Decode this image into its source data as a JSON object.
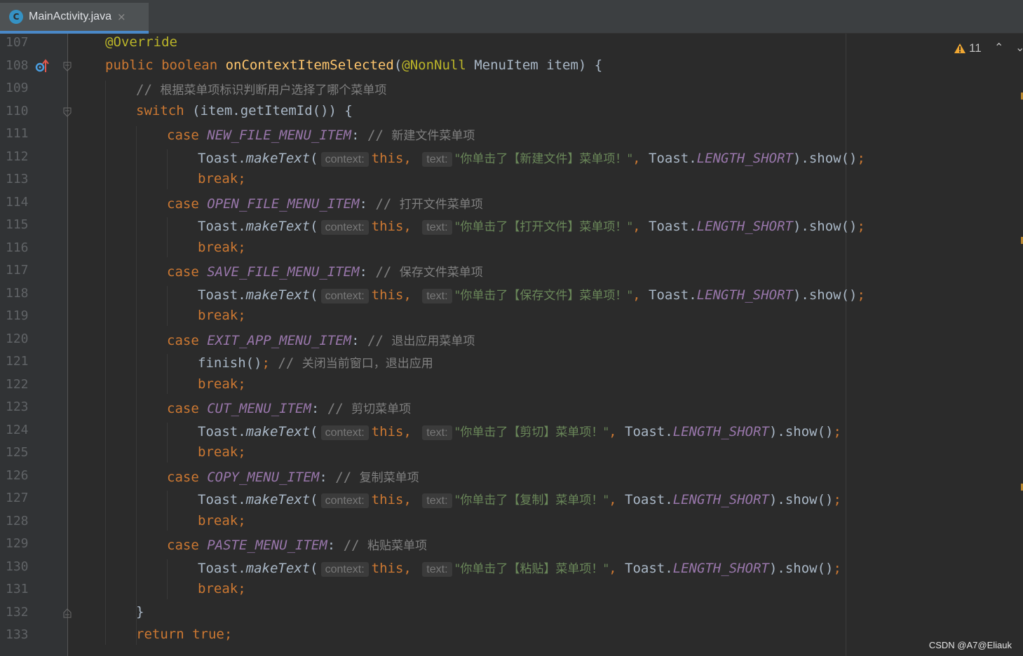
{
  "tab": {
    "icon_letter": "C",
    "filename": "MainActivity.java",
    "close_glyph": "×"
  },
  "inspection": {
    "warning_count": "11",
    "up_glyph": "⌃",
    "down_glyph": "⌄"
  },
  "hints": {
    "context": "context:",
    "text": "text:"
  },
  "watermark": "CSDN @A7@Eliauk",
  "lines": [
    {
      "n": "107",
      "indent": 0,
      "tokens": [
        [
          "ann",
          "@Override"
        ]
      ]
    },
    {
      "n": "108",
      "indent": 0,
      "tokens": [
        [
          "kw",
          "public boolean "
        ],
        [
          "fn",
          "onContextItemSelected"
        ],
        [
          "p",
          "("
        ],
        [
          "ann",
          "@NonNull "
        ],
        [
          "p",
          "MenuItem item) {"
        ]
      ]
    },
    {
      "n": "109",
      "indent": 1,
      "tokens": [
        [
          "cmt",
          "// "
        ],
        [
          "cmtcn",
          "根据菜单项标识判断用户选择了哪个菜单项"
        ]
      ]
    },
    {
      "n": "110",
      "indent": 1,
      "tokens": [
        [
          "kw",
          "switch "
        ],
        [
          "p",
          "(item.getItemId()) {"
        ]
      ]
    },
    {
      "n": "111",
      "indent": 2,
      "tokens": [
        [
          "kw",
          "case "
        ],
        [
          "cst",
          "NEW_FILE_MENU_ITEM"
        ],
        [
          "p",
          ": "
        ],
        [
          "cmt",
          "// "
        ],
        [
          "cmtcn",
          "新建文件菜单项"
        ]
      ]
    },
    {
      "n": "112",
      "indent": 3,
      "tokens": [
        [
          "p",
          "Toast."
        ],
        [
          "it",
          "makeText"
        ],
        [
          "p",
          "("
        ],
        [
          "hint",
          "context"
        ],
        [
          "kw",
          "this, "
        ],
        [
          "hint",
          "text"
        ],
        [
          "str",
          "\"你单击了【新建文件】菜单项！\""
        ],
        [
          "kw",
          ", "
        ],
        [
          "p",
          "Toast."
        ],
        [
          "cst",
          "LENGTH_SHORT"
        ],
        [
          "p",
          ").show()"
        ],
        [
          "kw",
          ";"
        ]
      ]
    },
    {
      "n": "113",
      "indent": 3,
      "tokens": [
        [
          "kw",
          "break;"
        ]
      ]
    },
    {
      "n": "114",
      "indent": 2,
      "tokens": [
        [
          "kw",
          "case "
        ],
        [
          "cst",
          "OPEN_FILE_MENU_ITEM"
        ],
        [
          "p",
          ": "
        ],
        [
          "cmt",
          "// "
        ],
        [
          "cmtcn",
          "打开文件菜单项"
        ]
      ]
    },
    {
      "n": "115",
      "indent": 3,
      "tokens": [
        [
          "p",
          "Toast."
        ],
        [
          "it",
          "makeText"
        ],
        [
          "p",
          "("
        ],
        [
          "hint",
          "context"
        ],
        [
          "kw",
          "this, "
        ],
        [
          "hint",
          "text"
        ],
        [
          "str",
          "\"你单击了【打开文件】菜单项！\""
        ],
        [
          "kw",
          ", "
        ],
        [
          "p",
          "Toast."
        ],
        [
          "cst",
          "LENGTH_SHORT"
        ],
        [
          "p",
          ").show()"
        ],
        [
          "kw",
          ";"
        ]
      ]
    },
    {
      "n": "116",
      "indent": 3,
      "tokens": [
        [
          "kw",
          "break;"
        ]
      ]
    },
    {
      "n": "117",
      "indent": 2,
      "tokens": [
        [
          "kw",
          "case "
        ],
        [
          "cst",
          "SAVE_FILE_MENU_ITEM"
        ],
        [
          "p",
          ": "
        ],
        [
          "cmt",
          "// "
        ],
        [
          "cmtcn",
          "保存文件菜单项"
        ]
      ]
    },
    {
      "n": "118",
      "indent": 3,
      "tokens": [
        [
          "p",
          "Toast."
        ],
        [
          "it",
          "makeText"
        ],
        [
          "p",
          "("
        ],
        [
          "hint",
          "context"
        ],
        [
          "kw",
          "this, "
        ],
        [
          "hint",
          "text"
        ],
        [
          "str",
          "\"你单击了【保存文件】菜单项！\""
        ],
        [
          "kw",
          ", "
        ],
        [
          "p",
          "Toast."
        ],
        [
          "cst",
          "LENGTH_SHORT"
        ],
        [
          "p",
          ").show()"
        ],
        [
          "kw",
          ";"
        ]
      ]
    },
    {
      "n": "119",
      "indent": 3,
      "tokens": [
        [
          "kw",
          "break;"
        ]
      ]
    },
    {
      "n": "120",
      "indent": 2,
      "tokens": [
        [
          "kw",
          "case "
        ],
        [
          "cst",
          "EXIT_APP_MENU_ITEM"
        ],
        [
          "p",
          ": "
        ],
        [
          "cmt",
          "// "
        ],
        [
          "cmtcn",
          "退出应用菜单项"
        ]
      ]
    },
    {
      "n": "121",
      "indent": 3,
      "tokens": [
        [
          "p",
          "finish()"
        ],
        [
          "kw",
          "; "
        ],
        [
          "cmt",
          "// "
        ],
        [
          "cmtcn",
          "关闭当前窗口，退出应用"
        ]
      ]
    },
    {
      "n": "122",
      "indent": 3,
      "tokens": [
        [
          "kw",
          "break;"
        ]
      ]
    },
    {
      "n": "123",
      "indent": 2,
      "tokens": [
        [
          "kw",
          "case "
        ],
        [
          "cst",
          "CUT_MENU_ITEM"
        ],
        [
          "p",
          ": "
        ],
        [
          "cmt",
          "// "
        ],
        [
          "cmtcn",
          "剪切菜单项"
        ]
      ]
    },
    {
      "n": "124",
      "indent": 3,
      "tokens": [
        [
          "p",
          "Toast."
        ],
        [
          "it",
          "makeText"
        ],
        [
          "p",
          "("
        ],
        [
          "hint",
          "context"
        ],
        [
          "kw",
          "this, "
        ],
        [
          "hint",
          "text"
        ],
        [
          "str",
          "\"你单击了【剪切】菜单项！\""
        ],
        [
          "kw",
          ", "
        ],
        [
          "p",
          "Toast."
        ],
        [
          "cst",
          "LENGTH_SHORT"
        ],
        [
          "p",
          ").show()"
        ],
        [
          "kw",
          ";"
        ]
      ]
    },
    {
      "n": "125",
      "indent": 3,
      "tokens": [
        [
          "kw",
          "break;"
        ]
      ]
    },
    {
      "n": "126",
      "indent": 2,
      "tokens": [
        [
          "kw",
          "case "
        ],
        [
          "cst",
          "COPY_MENU_ITEM"
        ],
        [
          "p",
          ": "
        ],
        [
          "cmt",
          "// "
        ],
        [
          "cmtcn",
          "复制菜单项"
        ]
      ]
    },
    {
      "n": "127",
      "indent": 3,
      "tokens": [
        [
          "p",
          "Toast."
        ],
        [
          "it",
          "makeText"
        ],
        [
          "p",
          "("
        ],
        [
          "hint",
          "context"
        ],
        [
          "kw",
          "this, "
        ],
        [
          "hint",
          "text"
        ],
        [
          "str",
          "\"你单击了【复制】菜单项！\""
        ],
        [
          "kw",
          ", "
        ],
        [
          "p",
          "Toast."
        ],
        [
          "cst",
          "LENGTH_SHORT"
        ],
        [
          "p",
          ").show()"
        ],
        [
          "kw",
          ";"
        ]
      ]
    },
    {
      "n": "128",
      "indent": 3,
      "tokens": [
        [
          "kw",
          "break;"
        ]
      ]
    },
    {
      "n": "129",
      "indent": 2,
      "tokens": [
        [
          "kw",
          "case "
        ],
        [
          "cst",
          "PASTE_MENU_ITEM"
        ],
        [
          "p",
          ": "
        ],
        [
          "cmt",
          "// "
        ],
        [
          "cmtcn",
          "粘贴菜单项"
        ]
      ]
    },
    {
      "n": "130",
      "indent": 3,
      "tokens": [
        [
          "p",
          "Toast."
        ],
        [
          "it",
          "makeText"
        ],
        [
          "p",
          "("
        ],
        [
          "hint",
          "context"
        ],
        [
          "kw",
          "this, "
        ],
        [
          "hint",
          "text"
        ],
        [
          "str",
          "\"你单击了【粘贴】菜单项！\""
        ],
        [
          "kw",
          ", "
        ],
        [
          "p",
          "Toast."
        ],
        [
          "cst",
          "LENGTH_SHORT"
        ],
        [
          "p",
          ").show()"
        ],
        [
          "kw",
          ";"
        ]
      ]
    },
    {
      "n": "131",
      "indent": 3,
      "tokens": [
        [
          "kw",
          "break;"
        ]
      ]
    },
    {
      "n": "132",
      "indent": 1,
      "tokens": [
        [
          "p",
          "}"
        ]
      ]
    },
    {
      "n": "133",
      "indent": 1,
      "tokens": [
        [
          "kw",
          "return true;"
        ]
      ]
    }
  ]
}
